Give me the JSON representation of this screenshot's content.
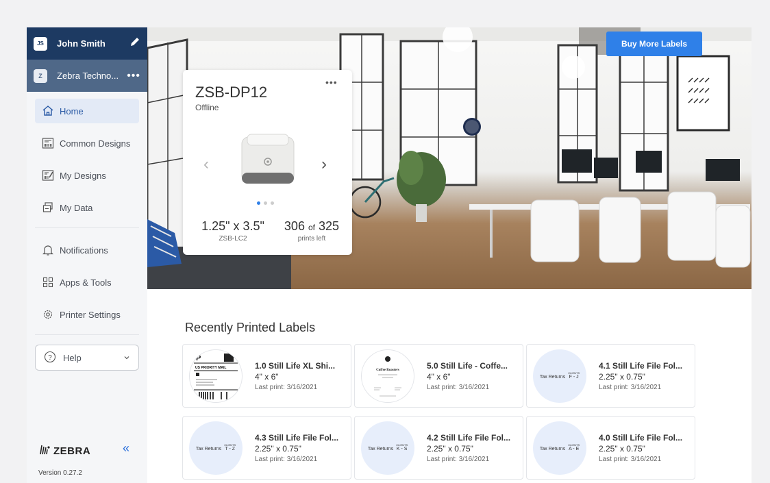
{
  "user": {
    "initials": "JS",
    "name": "John Smith"
  },
  "org": {
    "initial": "Z",
    "name": "Zebra Techno..."
  },
  "nav": [
    {
      "label": "Home"
    },
    {
      "label": "Common Designs"
    },
    {
      "label": "My Designs"
    },
    {
      "label": "My Data"
    },
    {
      "label": "Notifications"
    },
    {
      "label": "Apps & Tools"
    },
    {
      "label": "Printer Settings"
    }
  ],
  "help": {
    "label": "Help"
  },
  "brand": {
    "name": "ZEBRA"
  },
  "version": "Version 0.27.2",
  "hero": {
    "buy_label": "Buy More Labels"
  },
  "printer": {
    "name": "ZSB-DP12",
    "status": "Offline",
    "label_size": "1.25\" x 3.5\"",
    "cartridge": "ZSB-LC2",
    "prints_remaining": "306",
    "prints_of": "of",
    "prints_total": "325",
    "prints_caption": "prints left"
  },
  "recent": {
    "title": "Recently Printed Labels",
    "items": [
      {
        "name": "1.0 Still Life XL Shi...",
        "size": "4\" x 6\"",
        "last": "Last print: 3/16/2021",
        "thumb": "shipping"
      },
      {
        "name": "5.0 Still Life - Coffe...",
        "size": "4\" x 6\"",
        "last": "Last print: 3/16/2021",
        "thumb": "coffee"
      },
      {
        "name": "4.1 Still Life File Fol...",
        "size": "2.25\" x 0.75\"",
        "last": "Last print: 3/16/2021",
        "thumb": "tax",
        "range": "F - J"
      },
      {
        "name": "4.3 Still Life File Fol...",
        "size": "2.25\" x 0.75\"",
        "last": "Last print: 3/16/2021",
        "thumb": "tax",
        "range": "T - Z"
      },
      {
        "name": "4.2 Still Life File Fol...",
        "size": "2.25\" x 0.75\"",
        "last": "Last print: 3/16/2021",
        "thumb": "tax",
        "range": "K - S"
      },
      {
        "name": "4.0 Still Life File Fol...",
        "size": "2.25\" x 0.75\"",
        "last": "Last print: 3/16/2021",
        "thumb": "tax",
        "range": "A - E"
      }
    ],
    "tax_label": "Tax Returns",
    "tax_clients": "CLIENTS",
    "shipping_thumb": {
      "letter": "P",
      "service": "US PRIORITY MAIL"
    },
    "coffee_thumb": {
      "title": "Coffee Roasters"
    }
  },
  "colors": {
    "navy": "#1d3a62",
    "slate": "#4f6888",
    "accent": "#2f80e8",
    "active_bg": "#e3eaf6"
  }
}
